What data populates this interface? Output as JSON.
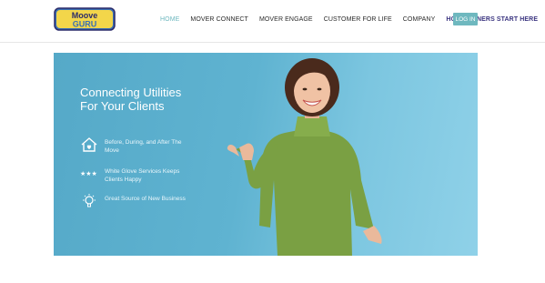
{
  "brand": {
    "logo_text_top": "Moove",
    "logo_text_bottom": "GURU"
  },
  "nav": {
    "items": [
      {
        "label": "HOME",
        "active": true
      },
      {
        "label": "MOVER CONNECT",
        "active": false
      },
      {
        "label": "MOVER ENGAGE",
        "active": false
      },
      {
        "label": "CUSTOMER FOR LIFE",
        "active": false
      },
      {
        "label": "COMPANY",
        "active": false
      },
      {
        "label": "HOMEOWNERS START HERE",
        "active": false
      }
    ],
    "login_label": "LOG IN"
  },
  "hero": {
    "title_line1": "Connecting Utilities",
    "title_line2": "For Your Clients",
    "features": [
      {
        "icon": "house-heart-icon",
        "text": "Before, During, and After The Move"
      },
      {
        "icon": "three-stars-icon",
        "text": "White Glove Services Keeps Clients Happy"
      },
      {
        "icon": "lightbulb-icon",
        "text": "Great Source of New Business"
      }
    ]
  },
  "colors": {
    "accent": "#6fb8bf",
    "homeowners": "#3b3580",
    "hero_blue": "#5fb3d1",
    "sweater_green": "#7aa043"
  }
}
